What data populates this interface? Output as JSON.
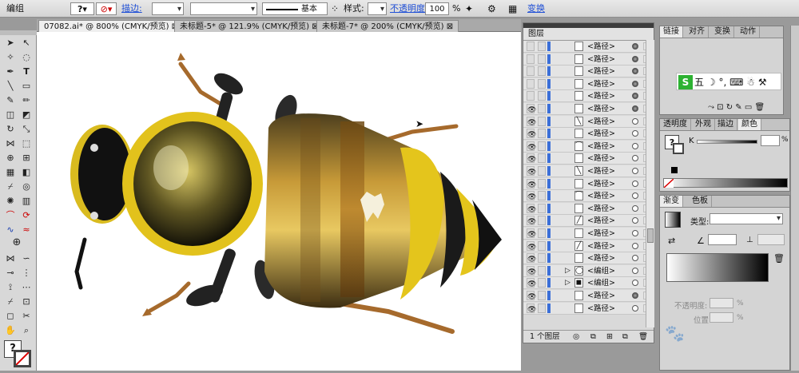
{
  "control_bar": {
    "group_label": "编组",
    "stroke_label": "描边:",
    "stroke_style": "基本",
    "style_label": "样式:",
    "opacity_label": "不透明度:",
    "opacity_value": "100",
    "percent": "%",
    "transform_label": "变换"
  },
  "tabs": [
    {
      "label": "07082.ai* @ 800% (CMYK/预览)"
    },
    {
      "label": "未标题-5* @ 121.9% (CMYK/预览)"
    },
    {
      "label": "未标题-7* @ 200% (CMYK/预览)"
    }
  ],
  "layers_panel": {
    "title": "图层",
    "footer_count": "1 个图层",
    "rows": [
      {
        "label": "<路径>",
        "target": "filled"
      },
      {
        "label": "<路径>",
        "target": "filled"
      },
      {
        "label": "<路径>",
        "target": "filled"
      },
      {
        "label": "<路径>",
        "target": "filled"
      },
      {
        "label": "<路径>",
        "target": "filled"
      },
      {
        "label": "<路径>",
        "target": "filled"
      },
      {
        "label": "<路径>",
        "target": "empty"
      },
      {
        "label": "<路径>",
        "target": "empty"
      },
      {
        "label": "<路径>",
        "target": "empty"
      },
      {
        "label": "<路径>",
        "target": "empty"
      },
      {
        "label": "<路径>",
        "target": "empty"
      },
      {
        "label": "<路径>",
        "target": "empty"
      },
      {
        "label": "<路径>",
        "target": "empty"
      },
      {
        "label": "<路径>",
        "target": "empty"
      },
      {
        "label": "<路径>",
        "target": "empty"
      },
      {
        "label": "<路径>",
        "target": "empty"
      },
      {
        "label": "<路径>",
        "target": "empty"
      },
      {
        "label": "<路径>",
        "target": "empty"
      },
      {
        "label": "<编组>",
        "target": "empty"
      },
      {
        "label": "<编组>",
        "target": "empty"
      },
      {
        "label": "<路径>",
        "target": "filled"
      },
      {
        "label": "<路径>",
        "target": "empty"
      }
    ]
  },
  "right_panels": {
    "top_tabs": [
      "链接",
      "对齐",
      "变换",
      "动作"
    ],
    "ime_text": "五",
    "appearance_tabs": [
      "透明度",
      "外观",
      "描边",
      "颜色"
    ],
    "color_channel": "K",
    "color_percent": "%",
    "gradient_tabs": [
      "渐变",
      "色板"
    ],
    "gradient_type_label": "类型:",
    "gradient_opacity_label": "不透明度:",
    "gradient_position_label": "位置:",
    "gradient_percent": "%"
  },
  "colors": {
    "link_blue": "#1f4fd6",
    "bee_yellow": "#e0c21a",
    "bee_brown": "#8a5a1e",
    "leg_brown": "#b06a2a"
  }
}
